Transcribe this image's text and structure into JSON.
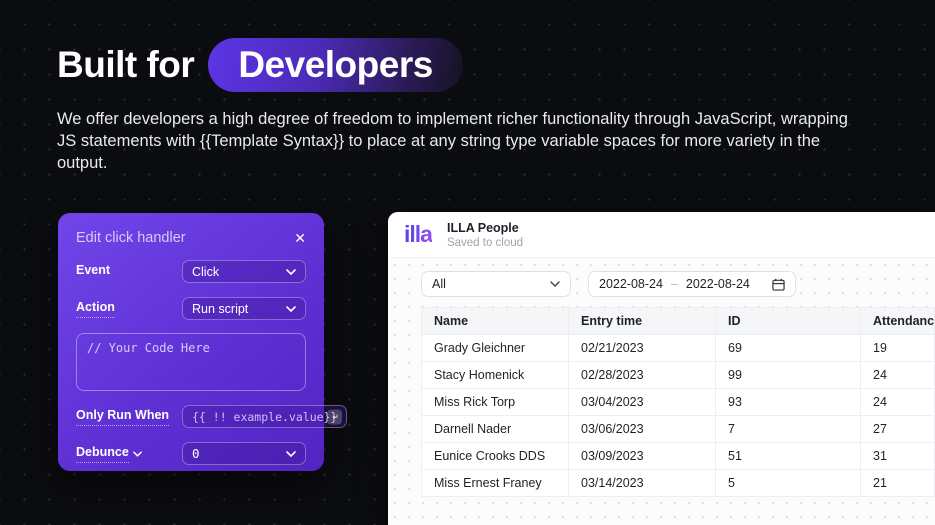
{
  "page": {
    "heading_prefix": "Built for",
    "heading_highlight": "Developers",
    "description": "We offer developers a high degree of freedom to implement richer functionality through JavaScript, wrapping JS statements with {{Template Syntax}} to place at any string type variable spaces for more variety in the output."
  },
  "icons": {
    "close": "✕",
    "js_badge": "↵"
  },
  "colors": {
    "accent_purple": "#5D35E6",
    "modal_purple_top": "#7146E9",
    "modal_purple_bottom": "#5224C2",
    "page_background": "#0B0C10",
    "panel_background": "#FFFFFF",
    "table_header_bg": "#F5F6F8"
  },
  "modal": {
    "title": "Edit click handler",
    "fields": {
      "event": {
        "label": "Event",
        "value": "Click"
      },
      "action": {
        "label": "Action",
        "value": "Run script"
      },
      "code": {
        "placeholder": "// Your Code Here"
      },
      "only_run_when": {
        "label": "Only Run When",
        "value": "{{ !! example.value}}"
      },
      "debounce": {
        "label": "Debunce",
        "value": "0"
      }
    }
  },
  "app": {
    "logo_text": "illa",
    "title": "ILLA People",
    "subtitle": "Saved to cloud",
    "filters": {
      "category_value": "All",
      "date_start": "2022-08-24",
      "date_separator": "–",
      "date_end": "2022-08-24"
    },
    "table": {
      "columns": [
        "Name",
        "Entry time",
        "ID",
        "Attendance"
      ],
      "rows": [
        [
          "Grady Gleichner",
          "02/21/2023",
          "69",
          "19"
        ],
        [
          "Stacy Homenick",
          "02/28/2023",
          "99",
          "24"
        ],
        [
          "Miss Rick Torp",
          "03/04/2023",
          "93",
          "24"
        ],
        [
          "Darnell Nader",
          "03/06/2023",
          "7",
          "27"
        ],
        [
          "Eunice Crooks DDS",
          "03/09/2023",
          "51",
          "31"
        ],
        [
          "Miss Ernest Franey",
          "03/14/2023",
          "5",
          "21"
        ]
      ]
    }
  }
}
